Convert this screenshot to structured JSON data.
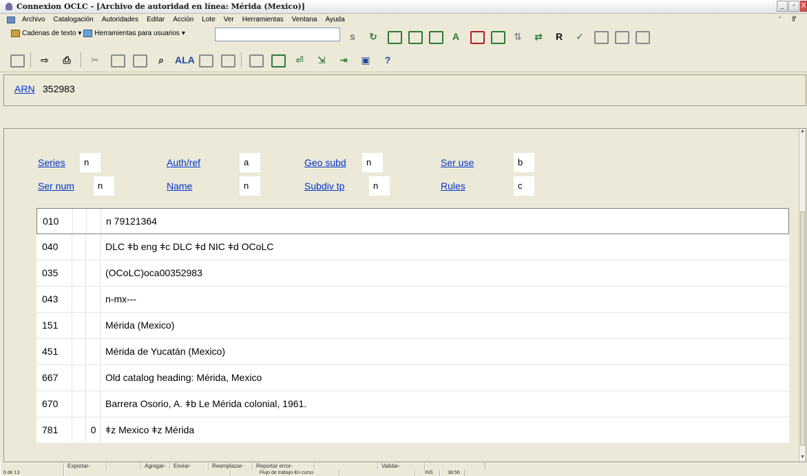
{
  "window": {
    "title": "Connexion OCLC - [Archivo de autoridad en línea: Mérida (Mexico)]",
    "controls": [
      "_",
      "▫",
      "X"
    ]
  },
  "menu": {
    "items": [
      "Archivo",
      "Catalogación",
      "Autoridades",
      "Editar",
      "Acción",
      "Lote",
      "Ver",
      "Herramientas",
      "Ventana",
      "Ayuda"
    ],
    "right_controls": "- ╔"
  },
  "toolbar1": {
    "text_strings_label": "Cadenas de texto",
    "user_tools_label": "Herramientas para usuarios",
    "dropdown_arrow": "▾",
    "input_value": "",
    "r_label": "R"
  },
  "toolbar2": {
    "ala_label": "ALA",
    "help_label": "?"
  },
  "arn": {
    "label": "ARN",
    "value": "352983"
  },
  "fixed_fields": [
    {
      "label": "Series",
      "value": "n"
    },
    {
      "label": "Auth/ref",
      "value": "a"
    },
    {
      "label": "Geo subd",
      "value": "n"
    },
    {
      "label": "Ser use",
      "value": "b"
    },
    {
      "label": "Ser num",
      "value": "n"
    },
    {
      "label": "Name",
      "value": "n"
    },
    {
      "label": "Subdiv tp",
      "value": "n"
    },
    {
      "label": "Rules",
      "value": "c"
    }
  ],
  "variable_fields": [
    {
      "tag": "010",
      "ind1": "",
      "ind2": "",
      "data": "n 79121364"
    },
    {
      "tag": "040",
      "ind1": "",
      "ind2": "",
      "data": "DLC ǂb eng ǂc DLC ǂd NIC ǂd OCoLC"
    },
    {
      "tag": "035",
      "ind1": "",
      "ind2": "",
      "data": "(OCoLC)oca00352983"
    },
    {
      "tag": "043",
      "ind1": "",
      "ind2": "",
      "data": "n-mx---"
    },
    {
      "tag": "151",
      "ind1": "",
      "ind2": "",
      "data": "Mérida (Mexico)"
    },
    {
      "tag": "451",
      "ind1": "",
      "ind2": "",
      "data": "Mérida de Yucatán (Mexico)"
    },
    {
      "tag": "667",
      "ind1": "",
      "ind2": "",
      "data": "Old catalog heading: Mérida, Mexico"
    },
    {
      "tag": "670",
      "ind1": "",
      "ind2": "",
      "data": "Barrera Osorio, A. ǂb Le Mérida colonial, 1961."
    },
    {
      "tag": "781",
      "ind1": "",
      "ind2": "0",
      "data": "ǂz Mexico ǂz Mérida"
    }
  ],
  "status": {
    "row1": [
      "",
      "Exportar-",
      "",
      "Agregar-",
      "Enviar-",
      "Reemplazar-",
      "Reportar error-",
      "",
      "Validar-",
      ""
    ],
    "row2": [
      "6 de 13",
      "",
      "Flujo de trabajo-En curso",
      "",
      "INS",
      "38:56"
    ]
  },
  "colors": {
    "background": "#ece9d8",
    "link_blue": "#0033cc"
  }
}
